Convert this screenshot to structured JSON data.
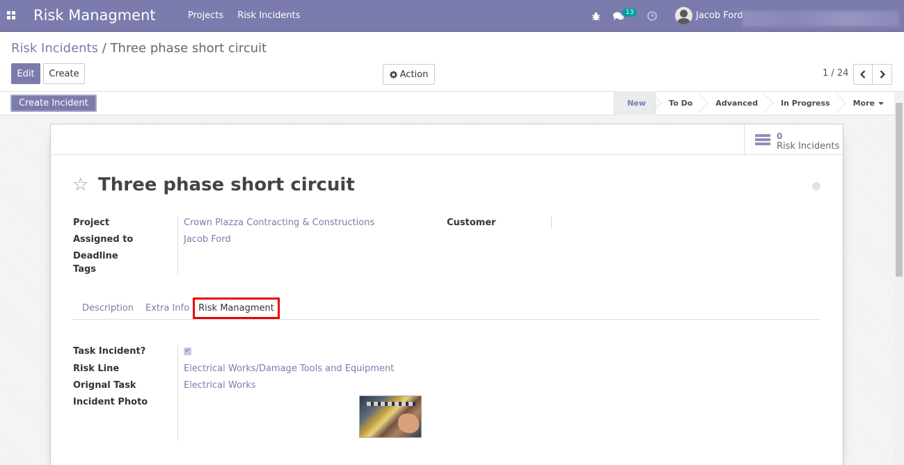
{
  "navbar": {
    "brand": "Risk Managment",
    "menu": [
      "Projects",
      "Risk Incidents"
    ],
    "chat_count": "13",
    "user_name": "Jacob Ford"
  },
  "control_panel": {
    "breadcrumb_parent": "Risk Incidents",
    "breadcrumb_separator": "/",
    "breadcrumb_current": "Three phase short circuit",
    "edit_label": "Edit",
    "create_label": "Create",
    "action_label": "Action",
    "pager": "1 / 24"
  },
  "statusbar": {
    "create_incident_label": "Create Incident",
    "stages": [
      "New",
      "To Do",
      "Advanced",
      "In Progress"
    ],
    "active_stage": "New",
    "more_label": "More"
  },
  "smart_button": {
    "count": "0",
    "label": "Risk Incidents"
  },
  "form": {
    "title": "Three phase short circuit",
    "fields_left": [
      {
        "label": "Project",
        "value": "Crown Plazza Contracting & Constructions"
      },
      {
        "label": "Assigned to",
        "value": "Jacob Ford"
      },
      {
        "label": "Deadline",
        "value": ""
      },
      {
        "label": "Tags",
        "value": ""
      }
    ],
    "fields_right": [
      {
        "label": "Customer",
        "value": ""
      }
    ],
    "tabs": [
      "Description",
      "Extra Info",
      "Risk Managment"
    ],
    "active_tab": "Risk Managment",
    "risk_fields": [
      {
        "label": "Task Incident?",
        "value": "checked"
      },
      {
        "label": "Risk Line",
        "value": "Electrical Works/Damage Tools and Equipment"
      },
      {
        "label": "Orignal Task",
        "value": "Electrical Works"
      },
      {
        "label": "Incident Photo",
        "value": ""
      }
    ]
  },
  "colors": {
    "brand": "#7c7bad",
    "highlight": "#ee0000",
    "badge": "#00a09d"
  }
}
